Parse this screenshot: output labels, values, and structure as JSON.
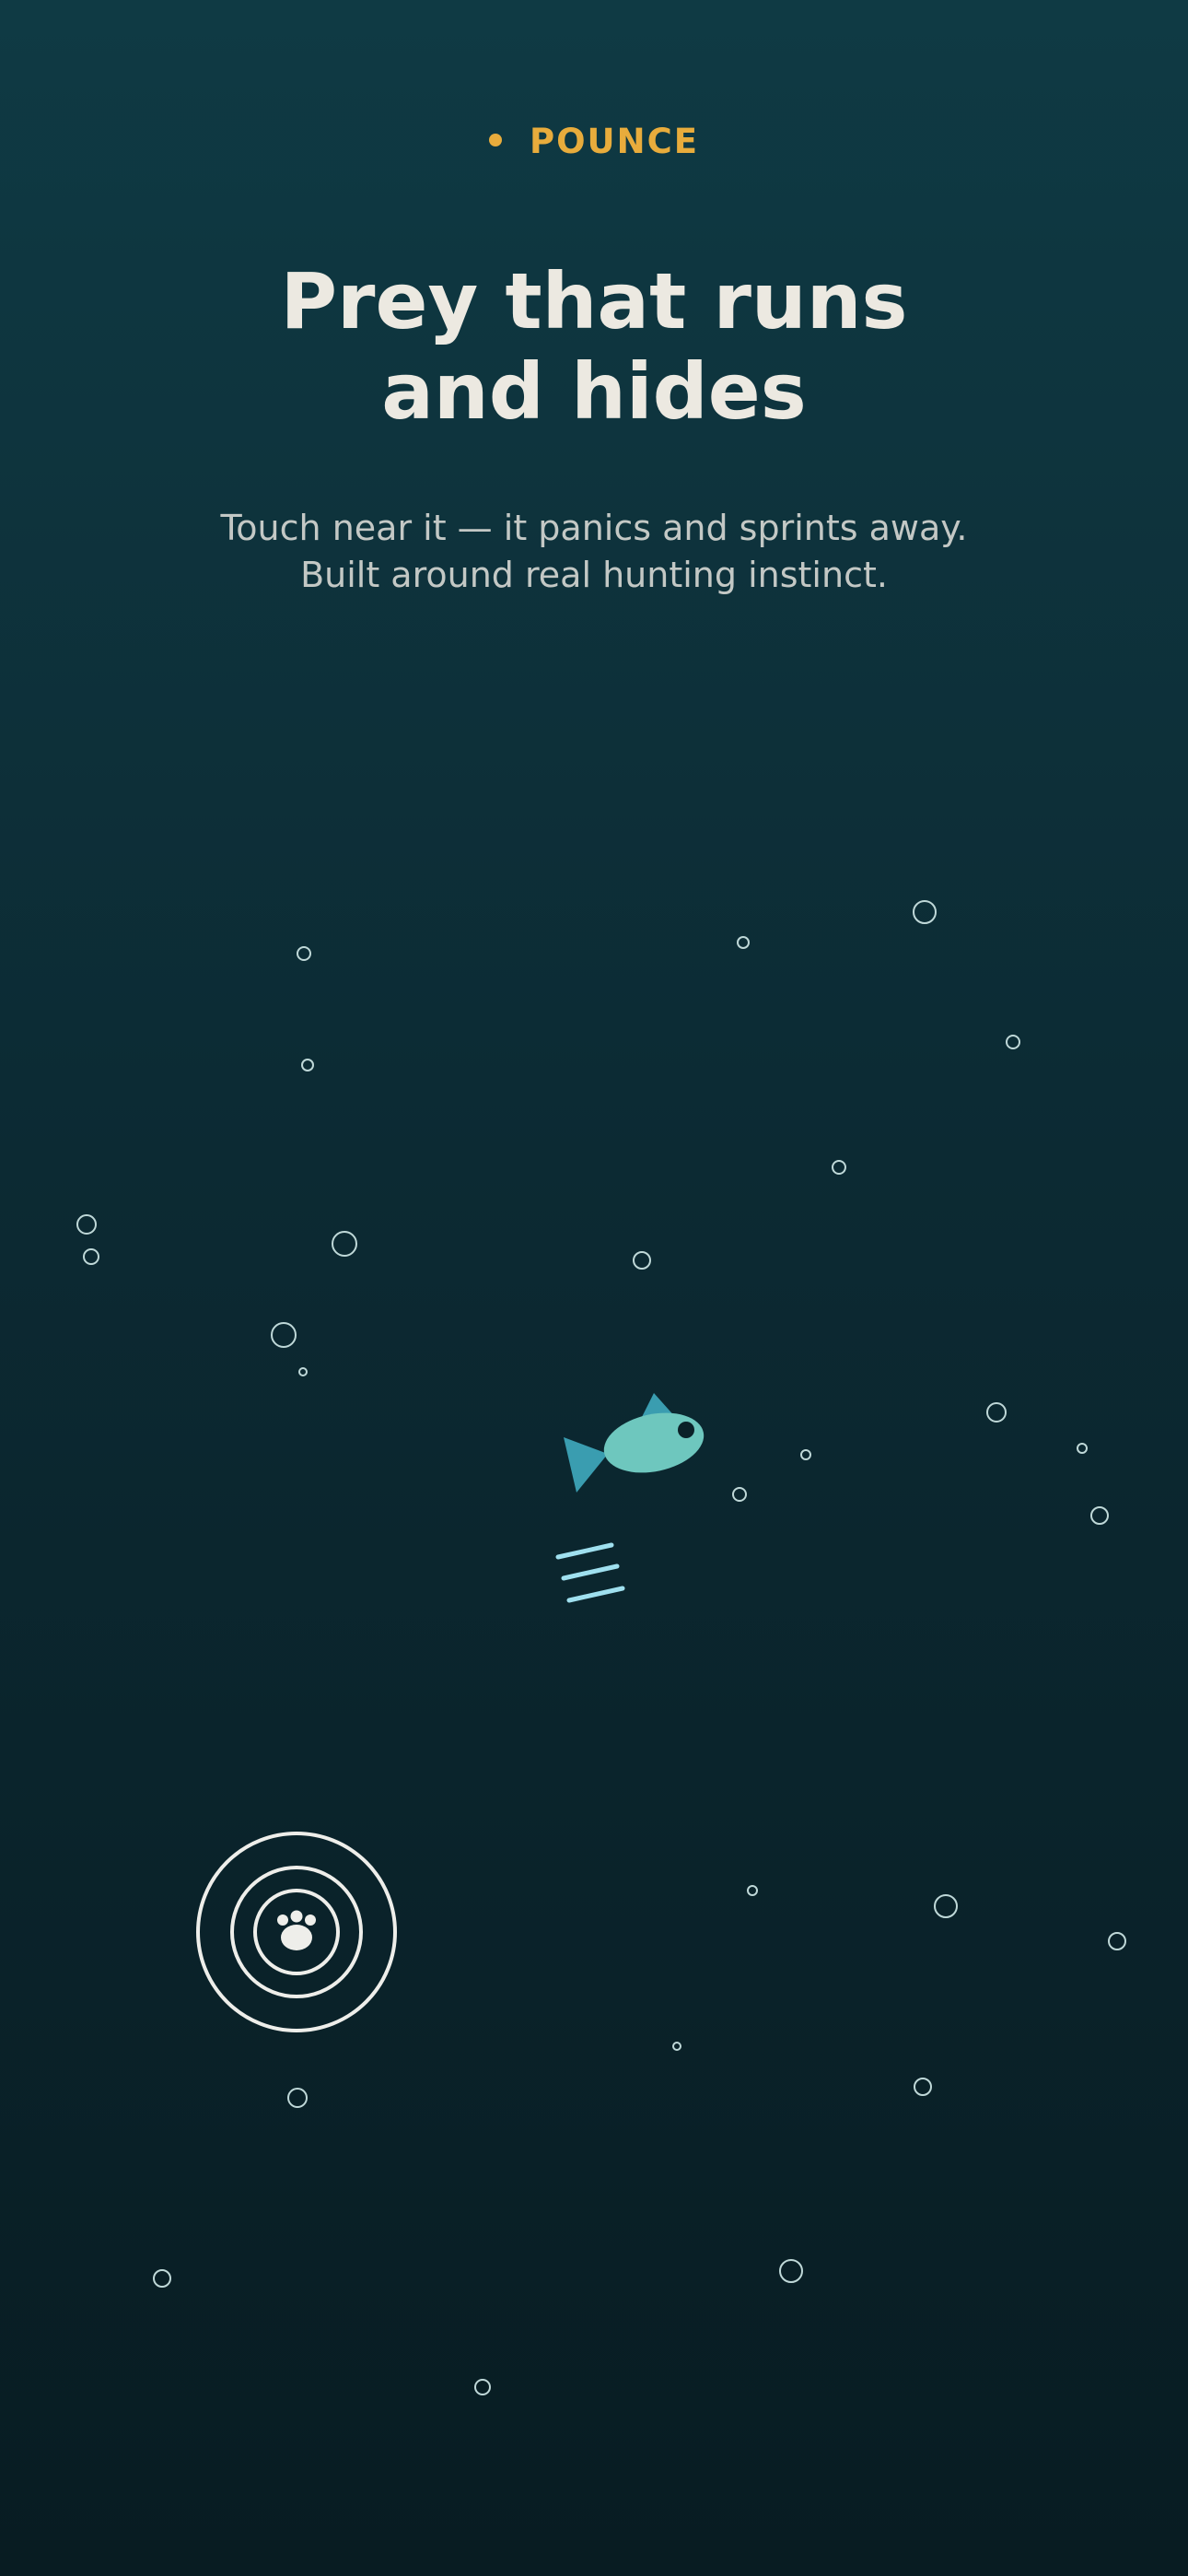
{
  "app": {
    "name": "POUNCE",
    "brand_color": "#e8ac3c"
  },
  "hero": {
    "title_line1": "Prey that runs",
    "title_line2": "and hides",
    "subtitle_line1": "Touch near it — it panics and sprints away.",
    "subtitle_line2": "Built around real hunting instinct."
  },
  "illustration": {
    "prey_icon": "fish-icon",
    "prey_body_color": "#6ec7be",
    "prey_fin_color": "#3a9db0",
    "motion_icon": "speed-lines-icon",
    "motion_color": "#9fe0ef",
    "touch_icon": "paw-print-icon",
    "ripple_color": "#eeeeea",
    "bubble_icon": "bubble-icon"
  }
}
